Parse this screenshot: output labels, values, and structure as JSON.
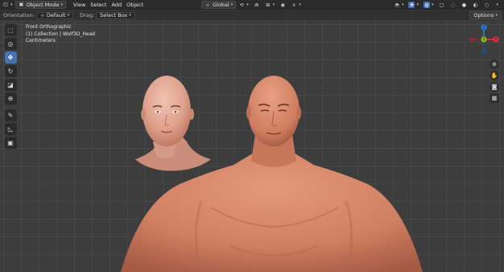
{
  "header": {
    "mode_label": "Object Mode",
    "menu": [
      "View",
      "Select",
      "Add",
      "Object"
    ],
    "transform_orientation": "Global"
  },
  "tool_settings": {
    "orientation_label": "Orientation:",
    "orientation_value": "Default",
    "drag_label": "Drag:",
    "drag_value": "Select Box",
    "options_label": "Options"
  },
  "viewport_overlay": {
    "view_name": "Front Orthographic",
    "collection": "(1) Collection | Wolf3D_Head",
    "units": "Centimeters"
  },
  "gizmo": {
    "axes": [
      {
        "label": "Z",
        "color": "#2a7fd9"
      },
      {
        "label": "X",
        "color": "#e0314b"
      },
      {
        "label": "Y",
        "color": "#83c018"
      }
    ]
  },
  "colors": {
    "accent": "#4772b3",
    "viewport_bg": "#3d3d3d",
    "skin": "#d98a6f"
  }
}
